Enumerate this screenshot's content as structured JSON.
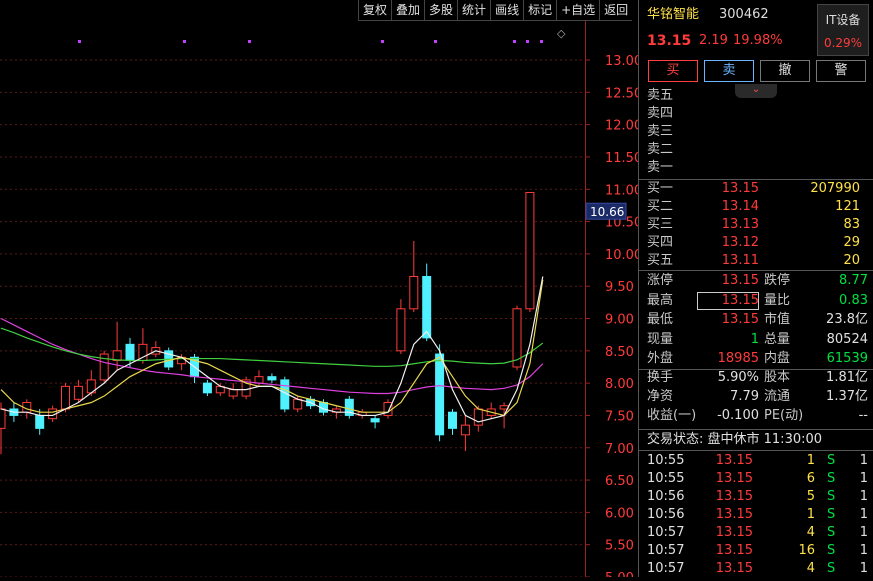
{
  "toolbar": [
    "复权",
    "叠加",
    "多股",
    "统计",
    "画线",
    "标记",
    "+自选",
    "返回"
  ],
  "chart_data": {
    "type": "candlestick",
    "y_ticks": [
      "13.00",
      "12.50",
      "12.00",
      "11.50",
      "11.00",
      "10.50",
      "10.00",
      "9.50",
      "9.00",
      "8.50",
      "8.00",
      "7.50",
      "7.00",
      "6.50",
      "6.00",
      "5.50",
      "5.00"
    ],
    "ylim": [
      5.0,
      13.0
    ],
    "price_marker": "10.66",
    "candles": [
      {
        "o": 7.3,
        "c": 7.6,
        "h": 7.7,
        "l": 6.9
      },
      {
        "o": 7.6,
        "c": 7.5,
        "h": 7.7,
        "l": 7.4
      },
      {
        "o": 7.55,
        "c": 7.7,
        "h": 7.75,
        "l": 7.45
      },
      {
        "o": 7.5,
        "c": 7.3,
        "h": 7.6,
        "l": 7.2
      },
      {
        "o": 7.45,
        "c": 7.6,
        "h": 7.65,
        "l": 7.4
      },
      {
        "o": 7.6,
        "c": 7.95,
        "h": 8.0,
        "l": 7.55
      },
      {
        "o": 7.75,
        "c": 7.95,
        "h": 8.05,
        "l": 7.7
      },
      {
        "o": 7.85,
        "c": 8.05,
        "h": 8.2,
        "l": 7.8
      },
      {
        "o": 8.05,
        "c": 8.45,
        "h": 8.5,
        "l": 8.0
      },
      {
        "o": 8.35,
        "c": 8.5,
        "h": 8.95,
        "l": 8.2
      },
      {
        "o": 8.6,
        "c": 8.35,
        "h": 8.7,
        "l": 8.25
      },
      {
        "o": 8.35,
        "c": 8.6,
        "h": 8.85,
        "l": 8.3
      },
      {
        "o": 8.45,
        "c": 8.55,
        "h": 8.65,
        "l": 8.4
      },
      {
        "o": 8.5,
        "c": 8.25,
        "h": 8.55,
        "l": 8.2
      },
      {
        "o": 8.3,
        "c": 8.4,
        "h": 8.45,
        "l": 8.2
      },
      {
        "o": 8.4,
        "c": 8.1,
        "h": 8.45,
        "l": 8.0
      },
      {
        "o": 8.0,
        "c": 7.85,
        "h": 8.05,
        "l": 7.8
      },
      {
        "o": 7.85,
        "c": 7.95,
        "h": 8.0,
        "l": 7.8
      },
      {
        "o": 7.8,
        "c": 7.9,
        "h": 8.0,
        "l": 7.75
      },
      {
        "o": 7.8,
        "c": 8.05,
        "h": 8.1,
        "l": 7.75
      },
      {
        "o": 8.0,
        "c": 8.1,
        "h": 8.2,
        "l": 7.95
      },
      {
        "o": 8.1,
        "c": 8.05,
        "h": 8.15,
        "l": 8.0
      },
      {
        "o": 8.05,
        "c": 7.6,
        "h": 8.1,
        "l": 7.55
      },
      {
        "o": 7.6,
        "c": 7.75,
        "h": 7.8,
        "l": 7.55
      },
      {
        "o": 7.75,
        "c": 7.65,
        "h": 7.8,
        "l": 7.6
      },
      {
        "o": 7.7,
        "c": 7.55,
        "h": 7.75,
        "l": 7.5
      },
      {
        "o": 7.55,
        "c": 7.6,
        "h": 7.65,
        "l": 7.45
      },
      {
        "o": 7.75,
        "c": 7.5,
        "h": 7.8,
        "l": 7.45
      },
      {
        "o": 7.5,
        "c": 7.55,
        "h": 7.6,
        "l": 7.45
      },
      {
        "o": 7.45,
        "c": 7.4,
        "h": 7.5,
        "l": 7.3
      },
      {
        "o": 7.5,
        "c": 7.7,
        "h": 7.75,
        "l": 7.45
      },
      {
        "o": 8.5,
        "c": 9.15,
        "h": 9.3,
        "l": 8.45
      },
      {
        "o": 9.15,
        "c": 9.65,
        "h": 10.2,
        "l": 9.1
      },
      {
        "o": 9.65,
        "c": 8.7,
        "h": 9.85,
        "l": 8.65
      },
      {
        "o": 8.45,
        "c": 7.2,
        "h": 8.6,
        "l": 7.1
      },
      {
        "o": 7.55,
        "c": 7.3,
        "h": 7.6,
        "l": 7.2
      },
      {
        "o": 7.2,
        "c": 7.35,
        "h": 7.5,
        "l": 6.95
      },
      {
        "o": 7.35,
        "c": 7.6,
        "h": 7.65,
        "l": 7.25
      },
      {
        "o": 7.5,
        "c": 7.6,
        "h": 7.7,
        "l": 7.45
      },
      {
        "o": 7.6,
        "c": 7.65,
        "h": 7.7,
        "l": 7.3
      },
      {
        "o": 8.25,
        "c": 9.15,
        "h": 9.2,
        "l": 8.2
      },
      {
        "o": 9.15,
        "c": 10.95,
        "h": 10.95,
        "l": 9.1
      }
    ],
    "ma_yellow": [
      7.9,
      7.7,
      7.6,
      7.55,
      7.55,
      7.6,
      7.65,
      7.7,
      7.8,
      7.95,
      8.1,
      8.2,
      8.3,
      8.35,
      8.4,
      8.35,
      8.3,
      8.2,
      8.1,
      8.0,
      7.95,
      7.95,
      7.9,
      7.8,
      7.75,
      7.7,
      7.65,
      7.6,
      7.55,
      7.55,
      7.55,
      7.7,
      8.0,
      8.3,
      8.4,
      8.1,
      7.8,
      7.6,
      7.55,
      7.5,
      7.7,
      8.3,
      9.6
    ],
    "ma_white": [
      7.6,
      7.55,
      7.55,
      7.5,
      7.5,
      7.6,
      7.7,
      7.85,
      8.0,
      8.2,
      8.3,
      8.4,
      8.5,
      8.45,
      8.4,
      8.25,
      8.1,
      7.95,
      7.9,
      7.9,
      7.95,
      7.95,
      7.85,
      7.75,
      7.7,
      7.6,
      7.55,
      7.55,
      7.5,
      7.5,
      7.55,
      8.0,
      8.6,
      8.8,
      8.5,
      7.9,
      7.5,
      7.4,
      7.45,
      7.5,
      7.9,
      8.6,
      9.65
    ],
    "ma_green": [
      8.85,
      8.78,
      8.7,
      8.63,
      8.56,
      8.5,
      8.45,
      8.41,
      8.38,
      8.36,
      8.35,
      8.35,
      8.36,
      8.37,
      8.38,
      8.38,
      8.38,
      8.38,
      8.37,
      8.36,
      8.35,
      8.34,
      8.33,
      8.32,
      8.31,
      8.3,
      8.29,
      8.28,
      8.27,
      8.26,
      8.26,
      8.27,
      8.3,
      8.33,
      8.35,
      8.34,
      8.32,
      8.31,
      8.3,
      8.31,
      8.36,
      8.47,
      8.62
    ],
    "ma_magenta": [
      9.0,
      8.9,
      8.8,
      8.7,
      8.6,
      8.52,
      8.45,
      8.38,
      8.32,
      8.28,
      8.24,
      8.2,
      8.17,
      8.15,
      8.13,
      8.1,
      8.08,
      8.06,
      8.04,
      8.02,
      8.0,
      7.98,
      7.96,
      7.94,
      7.92,
      7.9,
      7.88,
      7.86,
      7.85,
      7.84,
      7.84,
      7.86,
      7.9,
      7.94,
      7.96,
      7.94,
      7.92,
      7.91,
      7.9,
      7.92,
      7.97,
      8.1,
      8.3
    ]
  },
  "stock": {
    "name": "华铭智能",
    "code": "300462",
    "industry": "IT设备",
    "industry_pct": "0.29%",
    "price": "13.15",
    "change": "2.19",
    "change_pct": "19.98%"
  },
  "actions": [
    "买",
    "卖",
    "撤",
    "警"
  ],
  "sell_levels": [
    {
      "label": "卖五",
      "price": "",
      "vol": ""
    },
    {
      "label": "卖四",
      "price": "",
      "vol": ""
    },
    {
      "label": "卖三",
      "price": "",
      "vol": ""
    },
    {
      "label": "卖二",
      "price": "",
      "vol": ""
    },
    {
      "label": "卖一",
      "price": "",
      "vol": ""
    }
  ],
  "buy_levels": [
    {
      "label": "买一",
      "price": "13.15",
      "vol": "207990"
    },
    {
      "label": "买二",
      "price": "13.14",
      "vol": "121"
    },
    {
      "label": "买三",
      "price": "13.13",
      "vol": "83"
    },
    {
      "label": "买四",
      "price": "13.12",
      "vol": "29"
    },
    {
      "label": "买五",
      "price": "13.11",
      "vol": "20"
    }
  ],
  "stats": [
    {
      "l1": "涨停",
      "v1": "13.15",
      "l2": "跌停",
      "v2": "8.77"
    },
    {
      "l1": "最高",
      "v1": "13.15",
      "l2": "量比",
      "v2": "0.83"
    },
    {
      "l1": "最低",
      "v1": "13.15",
      "l2": "市值",
      "v2": "23.8亿"
    },
    {
      "l1": "现量",
      "v1": "1",
      "l2": "总量",
      "v2": "80524"
    },
    {
      "l1": "外盘",
      "v1": "18985",
      "l2": "内盘",
      "v2": "61539"
    }
  ],
  "stats2": [
    {
      "l1": "换手",
      "v1": "5.90%",
      "l2": "股本",
      "v2": "1.81亿"
    },
    {
      "l1": "净资",
      "v1": "7.79",
      "l2": "流通",
      "v2": "1.37亿"
    },
    {
      "l1": "收益(一)",
      "v1": "-0.100",
      "l2": "PE(动)",
      "v2": "--"
    }
  ],
  "trade_status": "交易状态: 盘中休市 11:30:00",
  "ticks": [
    {
      "time": "10:55",
      "price": "13.15",
      "vol": "1",
      "side": "S",
      "n": "1"
    },
    {
      "time": "10:55",
      "price": "13.15",
      "vol": "6",
      "side": "S",
      "n": "1"
    },
    {
      "time": "10:56",
      "price": "13.15",
      "vol": "5",
      "side": "S",
      "n": "1"
    },
    {
      "time": "10:56",
      "price": "13.15",
      "vol": "1",
      "side": "S",
      "n": "1"
    },
    {
      "time": "10:57",
      "price": "13.15",
      "vol": "4",
      "side": "S",
      "n": "1"
    },
    {
      "time": "10:57",
      "price": "13.15",
      "vol": "16",
      "side": "S",
      "n": "1"
    },
    {
      "time": "10:57",
      "price": "13.15",
      "vol": "4",
      "side": "S",
      "n": "1"
    }
  ]
}
